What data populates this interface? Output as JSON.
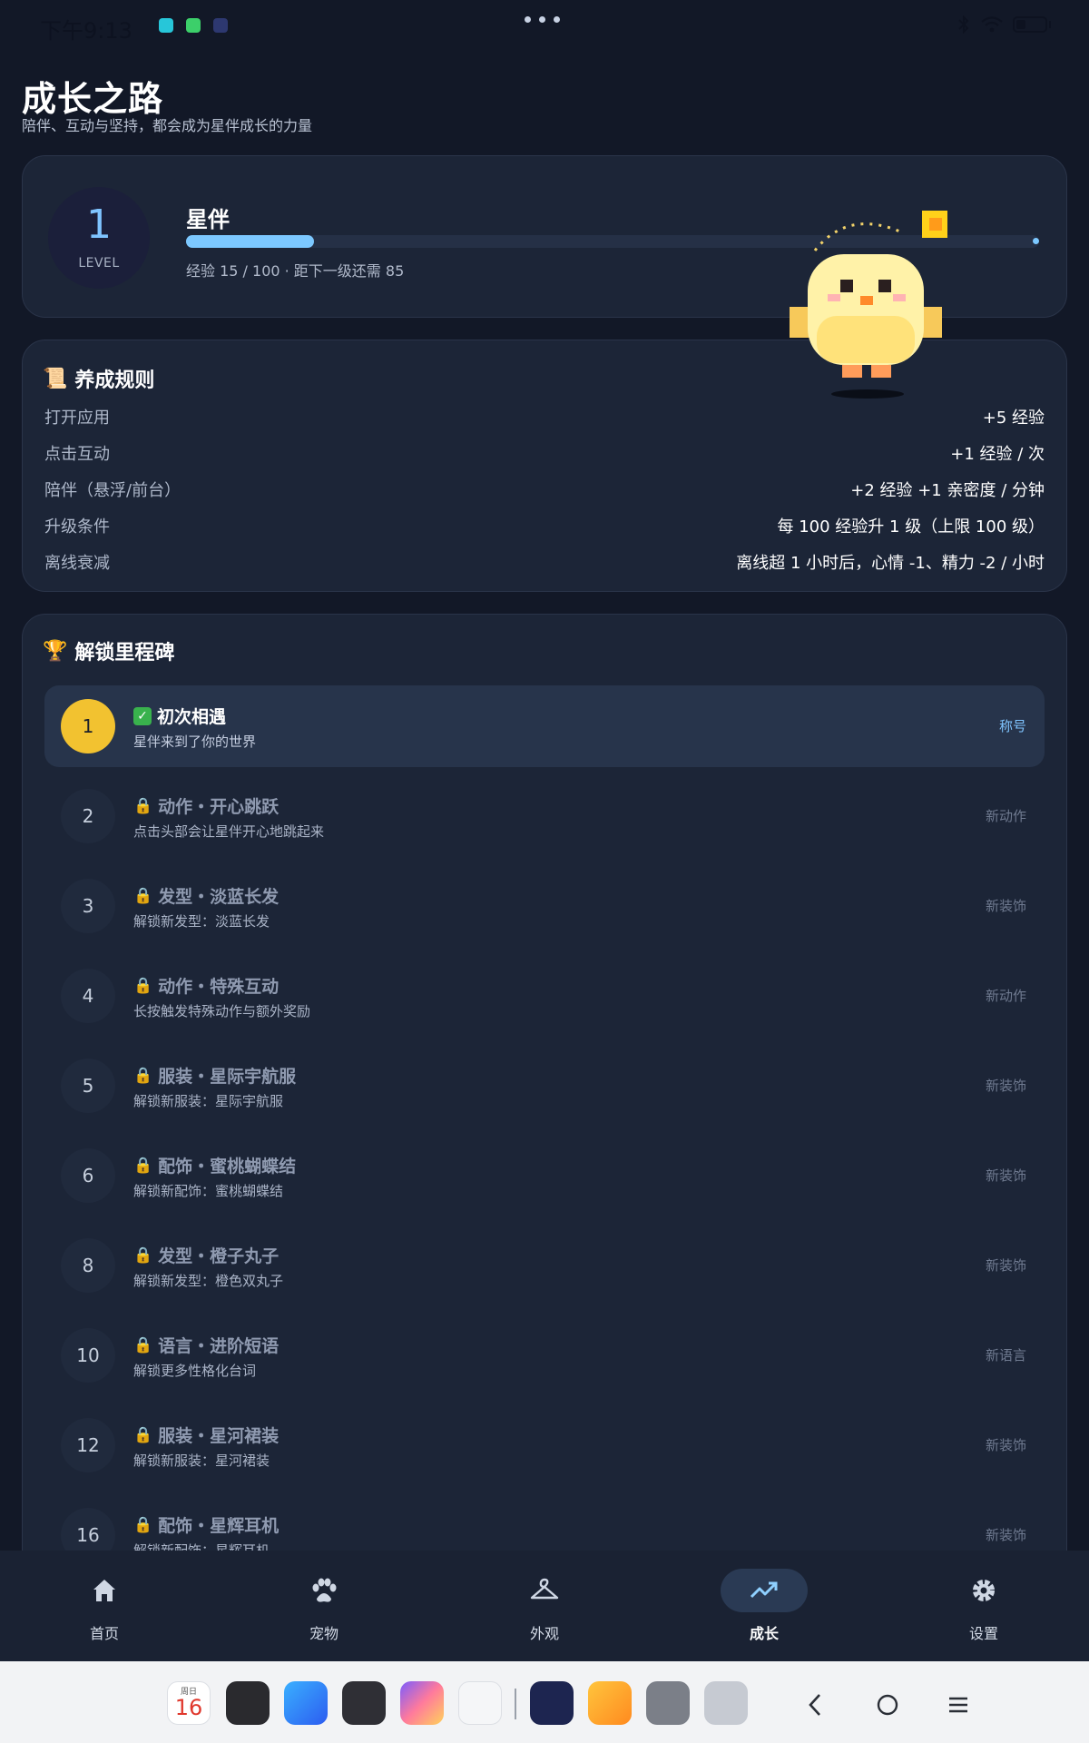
{
  "status_bar": {
    "time": "下午9:13"
  },
  "header": {
    "title": "成长之路",
    "subtitle": "陪伴、互动与坚持，都会成为星伴成长的力量"
  },
  "level_card": {
    "level": "1",
    "level_label": "LEVEL",
    "pet_name": "星伴",
    "xp_text": "经验 15 / 100 · 距下一级还需 85",
    "xp_fraction": 0.15,
    "accent": "#7cc8ff"
  },
  "rules": {
    "title": "养成规则",
    "icon": "scroll-icon",
    "items": [
      {
        "label": "打开应用",
        "value": "+5 经验"
      },
      {
        "label": "点击互动",
        "value": "+1 经验 / 次"
      },
      {
        "label": "陪伴（悬浮/前台）",
        "value": "+2 经验 +1 亲密度 / 分钟"
      },
      {
        "label": "升级条件",
        "value": "每 100 经验升 1 级（上限 100 级）"
      },
      {
        "label": "离线衰减",
        "value": "离线超 1 小时后，心情 -1、精力 -2 / 小时"
      }
    ]
  },
  "milestones": {
    "title": "解锁里程碑",
    "icon": "trophy-icon",
    "items": [
      {
        "level": "1",
        "title": "初次相遇",
        "desc": "星伴来到了你的世界",
        "tag": "称号",
        "unlocked": true
      },
      {
        "level": "2",
        "title": "动作・开心跳跃",
        "desc": "点击头部会让星伴开心地跳起来",
        "tag": "新动作",
        "unlocked": false
      },
      {
        "level": "3",
        "title": "发型・淡蓝长发",
        "desc": "解锁新发型：淡蓝长发",
        "tag": "新装饰",
        "unlocked": false
      },
      {
        "level": "4",
        "title": "动作・特殊互动",
        "desc": "长按触发特殊动作与额外奖励",
        "tag": "新动作",
        "unlocked": false
      },
      {
        "level": "5",
        "title": "服装・星际宇航服",
        "desc": "解锁新服装：星际宇航服",
        "tag": "新装饰",
        "unlocked": false
      },
      {
        "level": "6",
        "title": "配饰・蜜桃蝴蝶结",
        "desc": "解锁新配饰：蜜桃蝴蝶结",
        "tag": "新装饰",
        "unlocked": false
      },
      {
        "level": "8",
        "title": "发型・橙子丸子",
        "desc": "解锁新发型：橙色双丸子",
        "tag": "新装饰",
        "unlocked": false
      },
      {
        "level": "10",
        "title": "语言・进阶短语",
        "desc": "解锁更多性格化台词",
        "tag": "新语言",
        "unlocked": false
      },
      {
        "level": "12",
        "title": "服装・星河裙装",
        "desc": "解锁新服装：星河裙装",
        "tag": "新装饰",
        "unlocked": false
      },
      {
        "level": "16",
        "title": "配饰・星辉耳机",
        "desc": "解锁新配饰：星辉耳机",
        "tag": "新装饰",
        "unlocked": false
      }
    ]
  },
  "bottom_nav": {
    "active": "成长",
    "items": [
      {
        "label": "首页",
        "icon": "home-icon"
      },
      {
        "label": "宠物",
        "icon": "paw-icon"
      },
      {
        "label": "外观",
        "icon": "hanger-icon"
      },
      {
        "label": "成长",
        "icon": "trending-up-icon"
      },
      {
        "label": "设置",
        "icon": "gear-icon"
      }
    ]
  },
  "dock": {
    "calendar_weekday": "周日",
    "calendar_day": "16"
  }
}
